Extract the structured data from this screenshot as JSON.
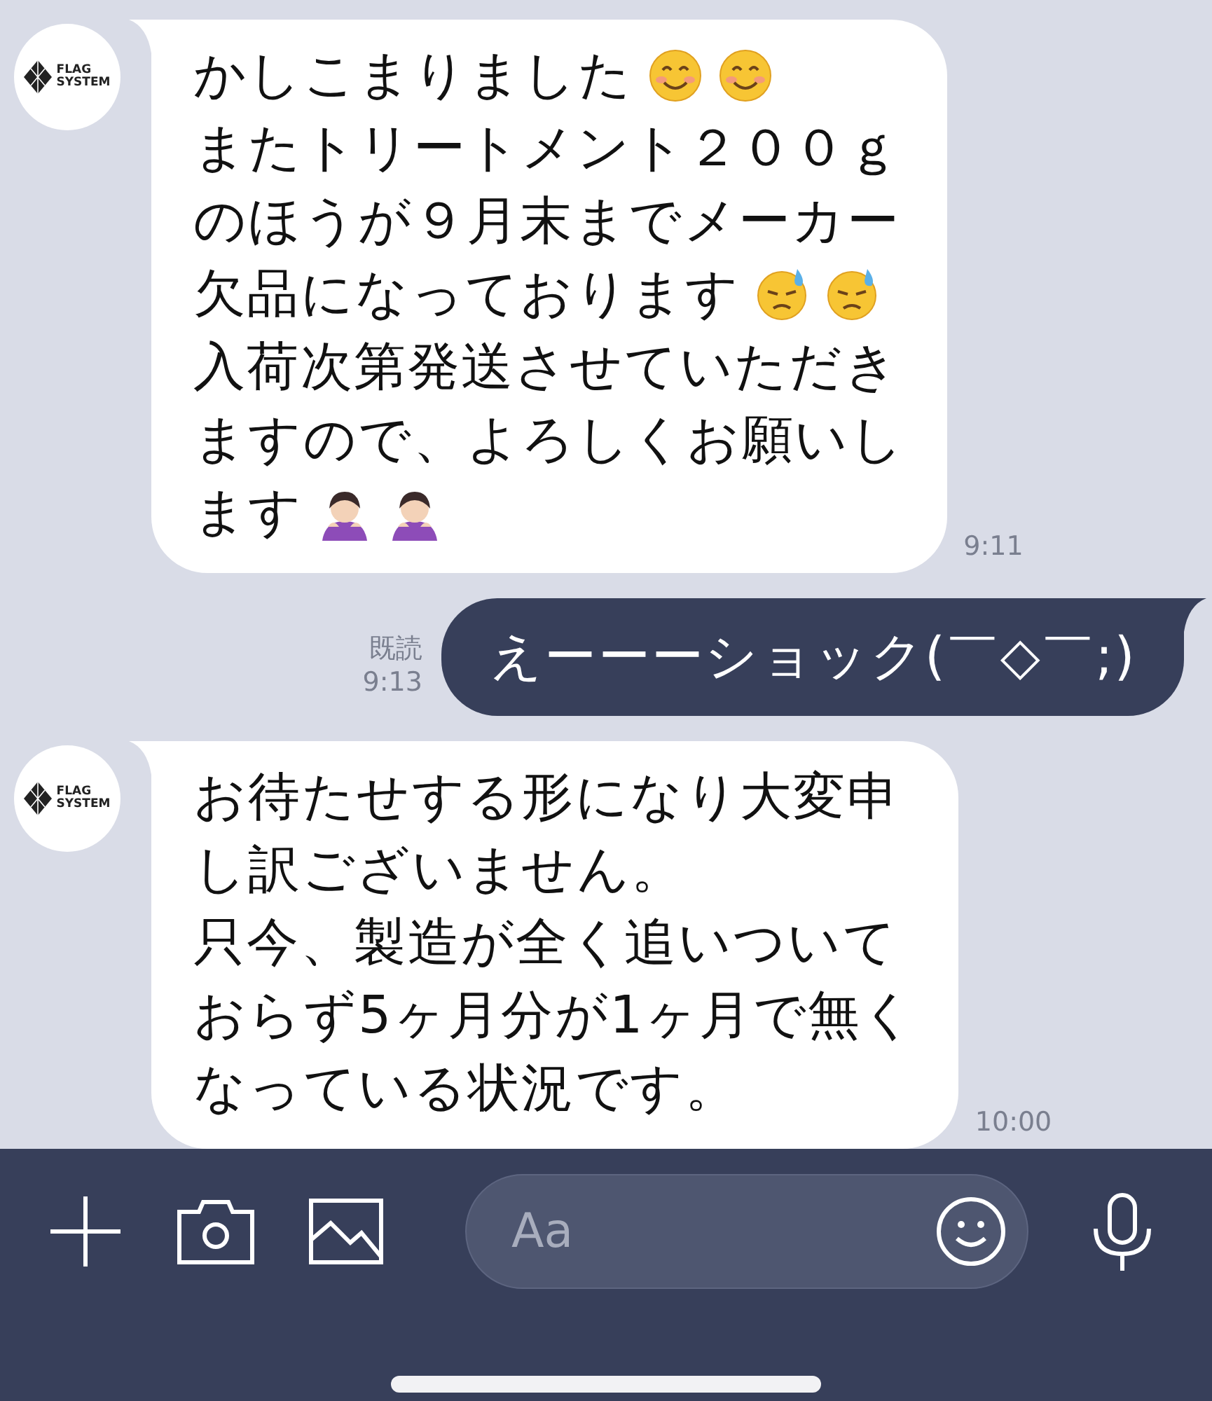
{
  "messages": [
    {
      "kind": "received",
      "avatar": {
        "logo_lines": [
          "FLAG",
          "SYSTEM"
        ]
      },
      "lines": [
        {
          "text": "かしこまりました",
          "icons": [
            {
              "kind": "smile"
            },
            {
              "kind": "smile"
            }
          ]
        },
        {
          "text": "またトリートメント２００ｇ"
        },
        {
          "text": "のほうが９月末までメーカー"
        },
        {
          "text": "欠品になっております",
          "icons": [
            {
              "kind": "sweat"
            },
            {
              "kind": "sweat"
            }
          ]
        },
        {
          "text": "入荷次第発送させていただき"
        },
        {
          "text": "ますので、よろしくお願いし"
        },
        {
          "text": "ます",
          "icons": [
            {
              "kind": "bow"
            },
            {
              "kind": "bow"
            }
          ]
        }
      ],
      "time": "9:11"
    },
    {
      "kind": "sent",
      "read": "既読",
      "lines": [
        {
          "text": "えーーーショック(￣◇￣;)"
        }
      ],
      "time": "9:13"
    },
    {
      "kind": "received",
      "avatar": {
        "logo_lines": [
          "FLAG",
          "SYSTEM"
        ]
      },
      "lines": [
        {
          "text": "お待たせする形になり大変申"
        },
        {
          "text": "し訳ございません。"
        },
        {
          "text": "只今、製造が全く追いついて"
        },
        {
          "text": "おらず5ヶ月分が1ヶ月で無く"
        },
        {
          "text": "なっている状況です。"
        }
      ],
      "time": "10:00"
    }
  ],
  "composer": {
    "placeholder": "Aa"
  }
}
